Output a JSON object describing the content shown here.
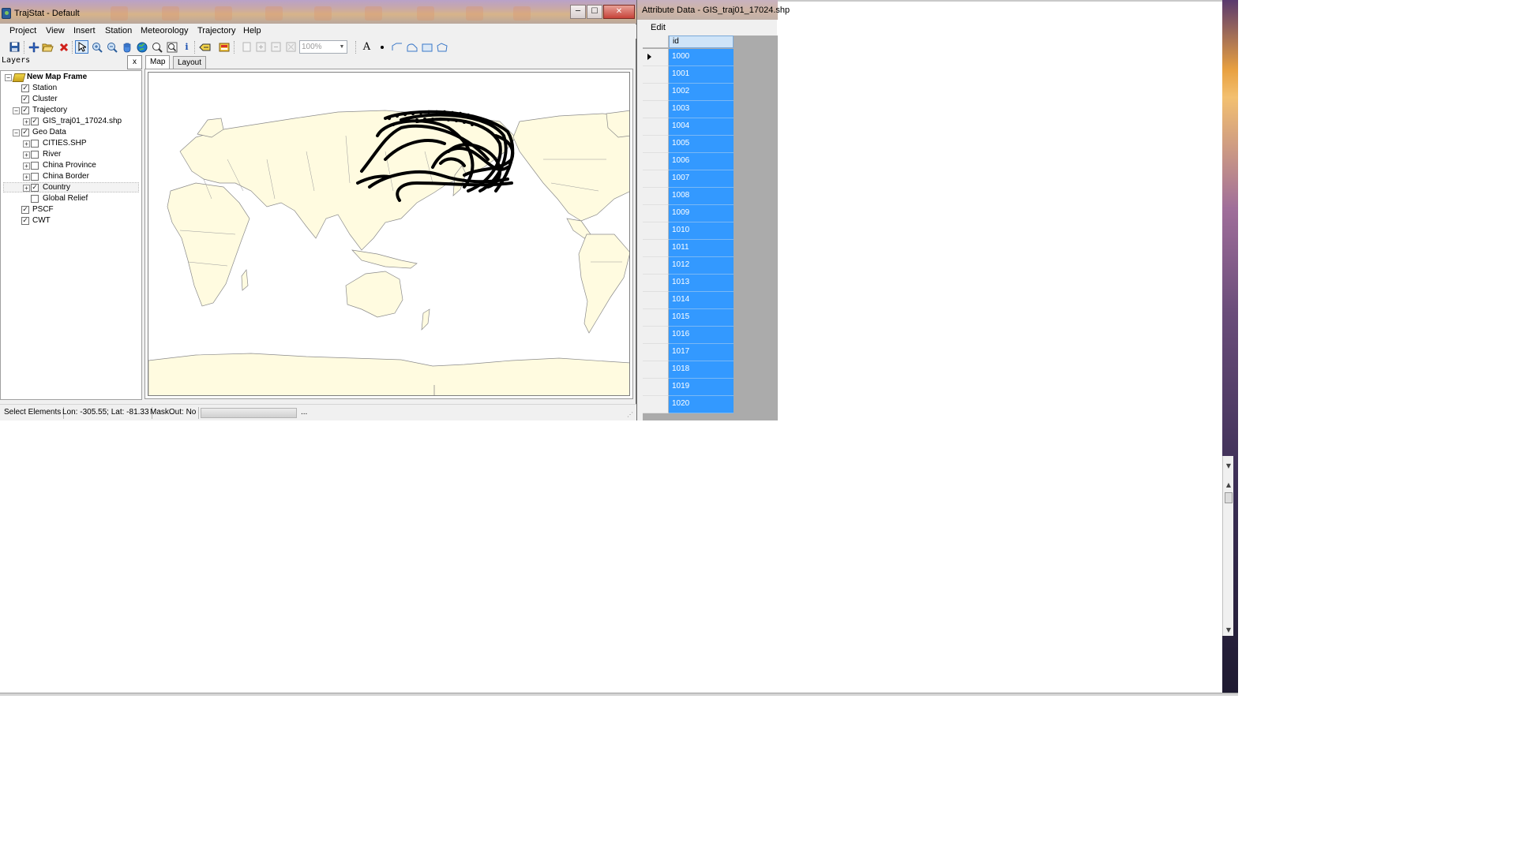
{
  "main_window": {
    "title": "TrajStat - Default",
    "caption": {
      "minimize": "─",
      "maximize": "☐",
      "close": "✕"
    },
    "menu": [
      "Project",
      "View",
      "Insert",
      "Station",
      "Meteorology",
      "Trajectory",
      "Help"
    ],
    "toolbar": {
      "zoom_value": "100%"
    }
  },
  "layers": {
    "title": "Layers",
    "close": "x",
    "tree": [
      {
        "label": "New Map Frame",
        "bold": true
      },
      {
        "label": "Station",
        "checked": true
      },
      {
        "label": "Cluster",
        "checked": true
      },
      {
        "label": "Trajectory",
        "checked": true,
        "expander": "−"
      },
      {
        "label": "GIS_traj01_17024.shp",
        "checked": true,
        "expander": "+"
      },
      {
        "label": "Geo Data",
        "checked": true,
        "expander": "−"
      },
      {
        "label": "CITIES.SHP",
        "checked": false,
        "expander": "+"
      },
      {
        "label": "River",
        "checked": false,
        "expander": "+"
      },
      {
        "label": "China Province",
        "checked": false,
        "expander": "+"
      },
      {
        "label": "China Border",
        "checked": false,
        "expander": "+"
      },
      {
        "label": "Country",
        "checked": true,
        "expander": "+"
      },
      {
        "label": "Global Relief",
        "checked": false
      },
      {
        "label": "PSCF",
        "checked": true
      },
      {
        "label": "CWT",
        "checked": true
      }
    ]
  },
  "map": {
    "tabs": [
      "Map",
      "Layout"
    ],
    "active_tab": "Map",
    "colors": {
      "land": "#fffbe0",
      "border": "#8a8a8a",
      "trajectory": "#000000"
    }
  },
  "status": {
    "mode": "Select Elements",
    "coords": "Lon: -305.55; Lat: -81.33",
    "maskout": "MaskOut: No",
    "ellipsis": "..."
  },
  "attribute_window": {
    "title": "Attribute Data - GIS_traj01_17024.shp",
    "menu": "Edit",
    "column": "id",
    "rows": [
      "1000",
      "1001",
      "1002",
      "1003",
      "1004",
      "1005",
      "1006",
      "1007",
      "1008",
      "1009",
      "1010",
      "1011",
      "1012",
      "1013",
      "1014",
      "1015",
      "1016",
      "1017",
      "1018",
      "1019",
      "1020"
    ],
    "selection_color": "#3399ff"
  }
}
